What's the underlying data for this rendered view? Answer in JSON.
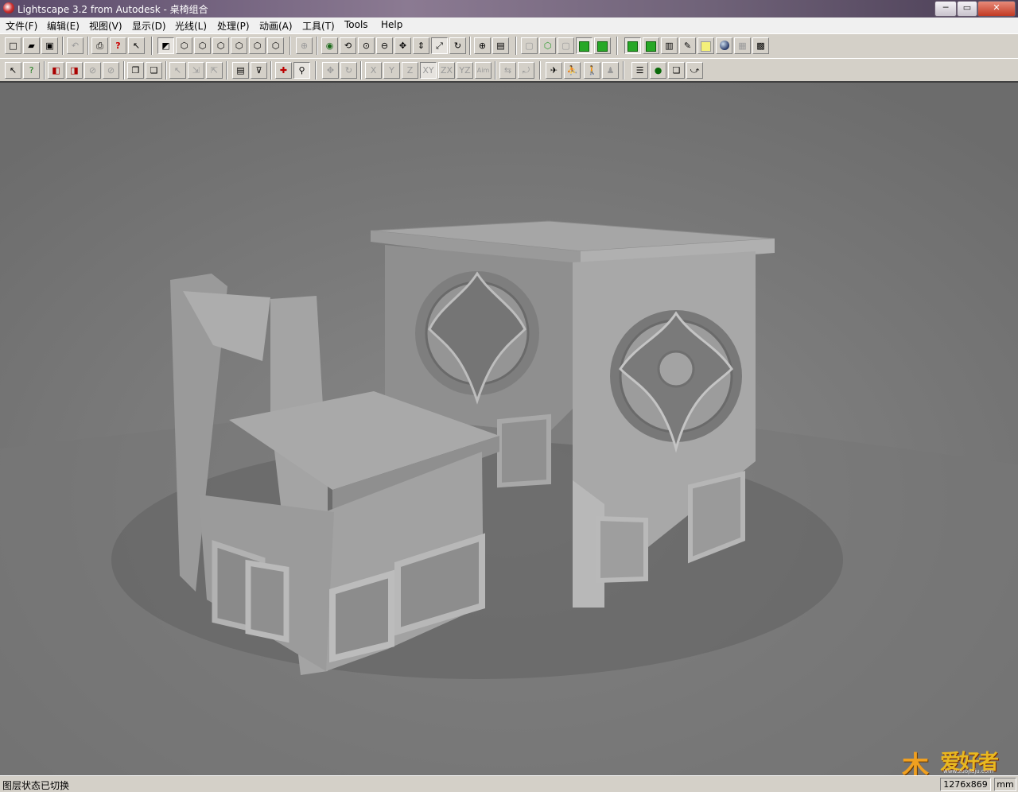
{
  "window": {
    "title": "Lightscape 3.2 from Autodesk - 桌椅组合",
    "minimize_label": "─",
    "maximize_label": "▭",
    "close_label": "✕"
  },
  "menubar": {
    "items": [
      {
        "label": "文件(F)"
      },
      {
        "label": "编辑(E)"
      },
      {
        "label": "视图(V)"
      },
      {
        "label": "显示(D)"
      },
      {
        "label": "光线(L)"
      },
      {
        "label": "处理(P)"
      },
      {
        "label": "动画(A)"
      },
      {
        "label": "工具(T)"
      },
      {
        "label": "Tools"
      },
      {
        "label": "Help"
      }
    ]
  },
  "toolbar2": {
    "axis_labels": [
      "X",
      "Y",
      "Z",
      "XY",
      "ZX",
      "YZ",
      "Aim"
    ]
  },
  "statusbar": {
    "message": "图层状态已切换",
    "resolution": "1276x869",
    "unit": "mm"
  },
  "watermark": {
    "char": "木",
    "text": "爱好者",
    "url": "www.zuojiaju.com"
  },
  "colors": {
    "viewport_background": "#7b7b7b",
    "model_surface": "#a8a8a8",
    "toolbar_green": "#27a827"
  }
}
